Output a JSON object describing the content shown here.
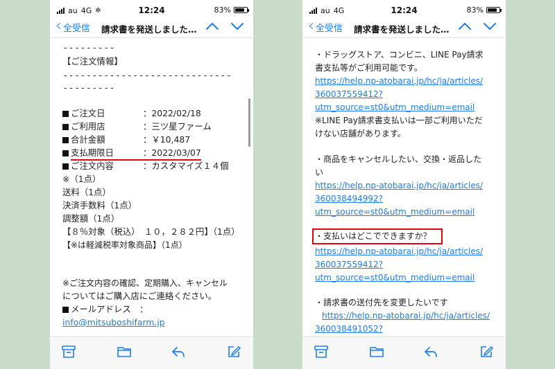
{
  "status": {
    "carrier": "au",
    "network": "4G",
    "time": "12:24",
    "battery": "83%",
    "battery_level": 0.83
  },
  "nav": {
    "back_label": "全受信",
    "title": "請求書を発送しました…"
  },
  "accent": "#1a7cf5",
  "highlight_color": "#e60012",
  "left": {
    "dash_short": "- - - - - - - - -",
    "section_header": "【ご注文情報】",
    "dash_long": "- - - - - - - - - - - - - - - - - - - - - - - - - - - - -",
    "dash_short2": "- - - - - - - - -",
    "order_date_label": "ご注文日",
    "order_date_value": "：2022/02/18",
    "store_label": "ご利用店",
    "store_value": "：三ツ星ファーム",
    "total_label": "合計金額",
    "total_value": "：￥10,487",
    "deadline_label": "支払期限日",
    "deadline_value": "：2022/03/07",
    "contents_label": "ご注文内容",
    "contents_value": "：カスタマイズ１４個",
    "item_note": "※（1点）",
    "shipping": "送料（1点）",
    "fee": "決済手数料（1点）",
    "adjust": "調整額（1点）",
    "tax_line": "【８％対象（税込）　１０，２８２円】（1点）",
    "reduced_line": "【※は軽減税率対象商品】（1点）",
    "confirm_1": "※ご注文内容の確認、定期購入、キャンセル",
    "confirm_2": "についてはご購入店にご連絡ください。",
    "mail_label": "メールアドレス　：",
    "mail_value": "info@mitsuboshifarm.jp"
  },
  "right": {
    "b1_1": "・ドラッグストア、コンビニ、LINE Pay請求",
    "b1_2": "書支払等がご利用可能です。",
    "link1_1": "https://help.np-atobarai.jp/hc/ja/articles/",
    "link1_2": "360037559412?",
    "link1_3": "utm_source=st0&utm_medium=email",
    "note1_1": "※LINE Pay請求書支払いは一部ご利用いただ",
    "note1_2": "けない店舗があります。",
    "b2_1": "・商品をキャンセルしたい、交換・返品した",
    "b2_2": "い",
    "link2_1": "https://help.np-atobarai.jp/hc/ja/articles/",
    "link2_2": "360038494992?",
    "link2_3": "utm_source=st0&utm_medium=email",
    "b3": "・支払いはどこでできますか？",
    "link3_1": "https://help.np-atobarai.jp/hc/ja/articles/",
    "link3_2": "360037559412?",
    "link3_3": "utm_source=st0&utm_medium=email",
    "b4": "・請求書の送付先を変更したいです",
    "link4_1": "https://help.np-atobarai.jp/hc/ja/articles/",
    "link4_2": "360038491052?"
  },
  "icons": {
    "toolbar": [
      "archive-icon",
      "folder-icon",
      "reply-icon",
      "compose-icon"
    ],
    "nav": [
      "chevron-up-icon",
      "chevron-down-icon"
    ]
  }
}
